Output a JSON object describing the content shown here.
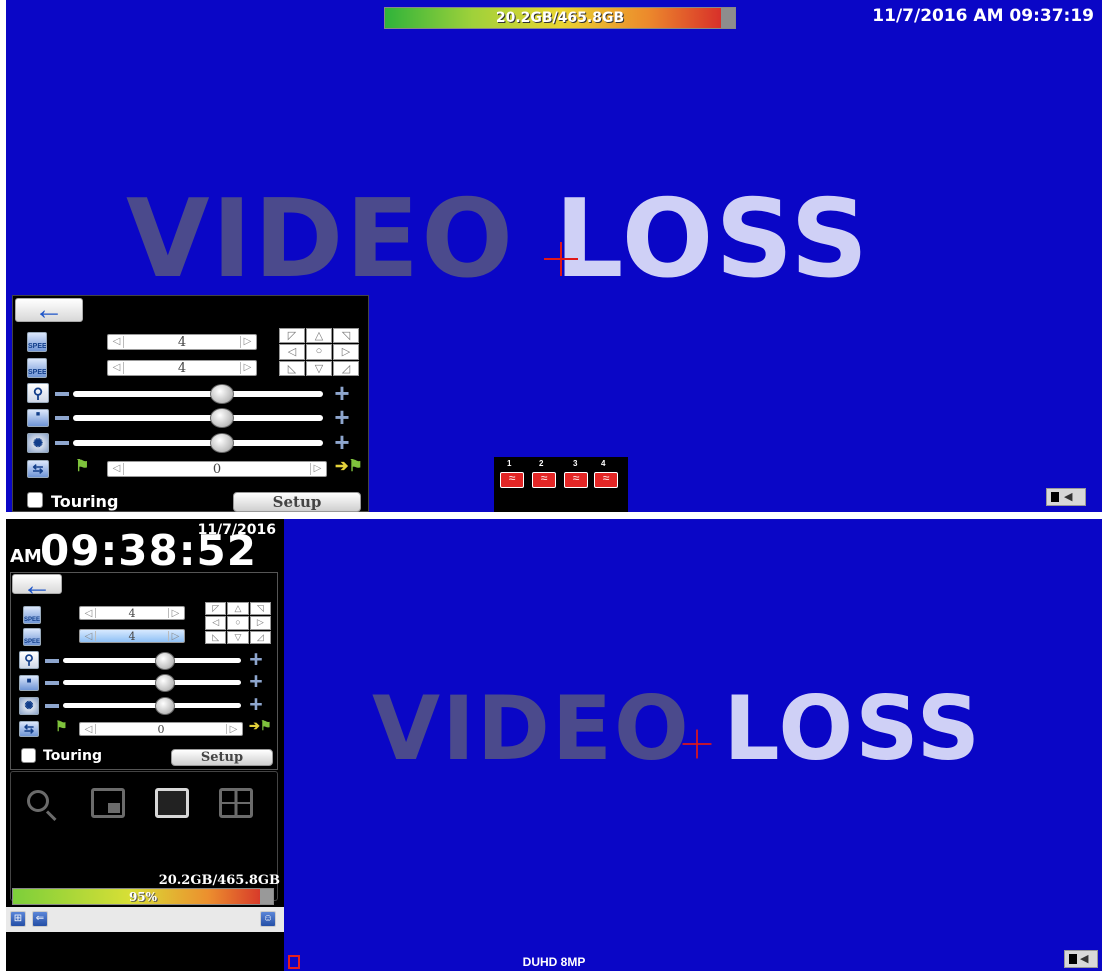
{
  "top_screen": {
    "hdd_usage": "20.2GB/465.8GB",
    "hdd_fill_percent": 96,
    "datetime": "11/7/2016 AM 09:37:19",
    "video_loss": {
      "word1": "VIDEO",
      "word2": "LOSS"
    },
    "ptz": {
      "speed_icon": "SPEED",
      "speed_value": "4",
      "pt_speed_icon": "SPEED",
      "pt_speed_value": "4",
      "preset_value": "0",
      "touring_label": "Touring",
      "setup_label": "Setup",
      "zoom_level": 0.5,
      "focus_level": 0.5,
      "iris_level": 0.5
    },
    "channels": [
      "1",
      "2",
      "3",
      "4"
    ]
  },
  "bottom_screen": {
    "clock_date": "11/7/2016",
    "clock_ampm": "AM",
    "clock_time": "09:38:52",
    "video_loss": {
      "word1": "VIDEO",
      "word2": "LOSS"
    },
    "ptz": {
      "speed_icon": "SPEED",
      "speed_value": "4",
      "pt_speed_icon": "SPEED",
      "pt_speed_value": "4",
      "preset_value": "0",
      "touring_label": "Touring",
      "setup_label": "Setup"
    },
    "hdd_usage": "20.2GB/465.8GB",
    "hdd_percent": "95%",
    "status": "DUHD 8MP"
  },
  "colors": {
    "background": "#0a06c6",
    "panel": "#000000",
    "video_loss_dark": "#4b4a8c",
    "video_loss_light": "#cfd0f6",
    "crosshair": "#e01818",
    "channel_icon": "#e22525"
  },
  "icons": {
    "back": "arrow-left-icon",
    "zoom": "magnifier-icon",
    "focus": "focus-icon",
    "iris": "iris-icon",
    "preset": "preset-return-icon",
    "flag": "flag-icon",
    "camera": "camera-icon",
    "view_search": "search-icon",
    "view_pip": "pip-icon",
    "view_single": "single-view-icon",
    "view_quad": "quad-view-icon",
    "network": "network-icon",
    "usb": "usb-icon",
    "user": "user-icon",
    "record": "record-icon"
  }
}
